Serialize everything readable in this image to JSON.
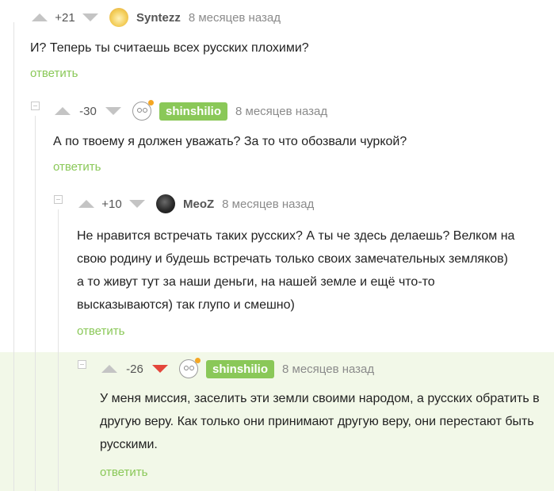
{
  "comments": [
    {
      "score": "+21",
      "username": "Syntezz",
      "time": "8 месяцев назад",
      "text": "И? Теперь ты считаешь всех русских плохими?",
      "reply_label": "ответить"
    },
    {
      "score": "-30",
      "username": "shinshilio",
      "time": "8 месяцев назад",
      "text": "А по твоему я должен уважать? За то что обозвали чуркой?",
      "reply_label": "ответить"
    },
    {
      "score": "+10",
      "username": "MeoZ",
      "time": "8 месяцев назад",
      "text": "Не нравится встречать таких русских? А ты че здесь делаешь? Велком на свою родину и будешь встречать только своих замечательных земляков) а то живут тут за наши деньги, на нашей земле и ещё что-то высказываются) так глупо и смешно)",
      "reply_label": "ответить"
    },
    {
      "score": "-26",
      "username": "shinshilio",
      "time": "8 месяцев назад",
      "text": "У меня миссия, заселить эти земли своими народом, а русских обратить в другую веру. Как только они принимают другую веру, они перестают быть русскими.",
      "reply_label": "ответить",
      "vote": "down"
    }
  ],
  "colors": {
    "accent_green": "#8ac858",
    "downvote_red": "#e4463b",
    "highlight_bg": "#f2f8e8"
  }
}
